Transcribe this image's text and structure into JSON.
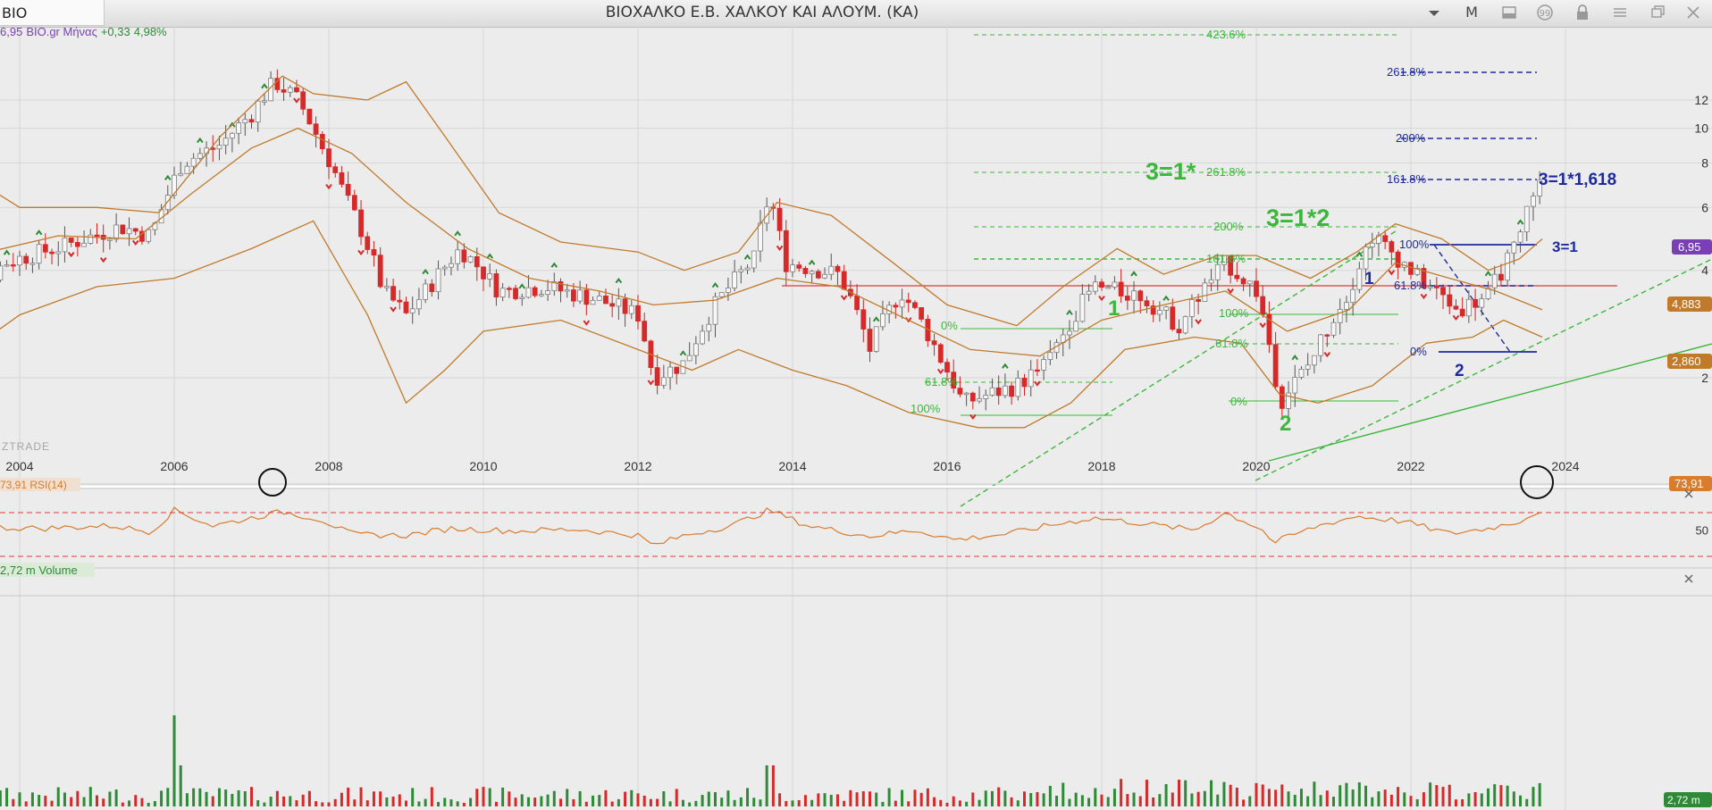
{
  "symbol": "BIO",
  "title": "ΒΙΟΧΑΛΚΟ Ε.Β. ΧΑΛΚΟΥ ΚΑΙ ΑΛΟΥΜ. (ΚΑ)",
  "period_button": "M",
  "toolbar_icons": [
    "chevron-down-icon",
    "layout-icon",
    "comment-icon",
    "lock-icon",
    "menu-icon",
    "restore-icon",
    "close-icon"
  ],
  "price_info": {
    "price": "6,95",
    "source": "BIO.gr Μήνας",
    "change": "+0,33",
    "change_pct": "4,98%"
  },
  "watermark": "ZTRADE",
  "rsi_label": "73,91 RSI(14)",
  "volume_label": "2,72 m Volume",
  "badges": {
    "price": "6,95",
    "upper_band": "4,883",
    "lower_band": "2,860",
    "rsi": "73,91",
    "volume": "2,72 m"
  },
  "colors": {
    "up": "#2e8a36",
    "down": "#d62a2a",
    "band": "#c07a2a",
    "fib": "#3cb73c",
    "blue": "#1e2a9e",
    "rsi": "#d87c2e",
    "price_badge": "#7a3fb5"
  },
  "chart_data": {
    "type": "candlestick",
    "x_ticks": [
      "2004",
      "2006",
      "2008",
      "2010",
      "2012",
      "2014",
      "2016",
      "2018",
      "2020",
      "2022",
      "2024"
    ],
    "y_ticks": [
      "12",
      "10",
      "8",
      "6",
      "4",
      "2"
    ],
    "y_scale": "log",
    "price_path": [
      [
        2003.2,
        2.9
      ],
      [
        2003.8,
        4.2
      ],
      [
        2004.6,
        4.7
      ],
      [
        2005.3,
        5.3
      ],
      [
        2005.7,
        5.0
      ],
      [
        2005.9,
        6.4
      ],
      [
        2006.1,
        8.0
      ],
      [
        2006.6,
        9.0
      ],
      [
        2007.0,
        11.0
      ],
      [
        2007.3,
        13.5
      ],
      [
        2007.6,
        12.0
      ],
      [
        2007.9,
        9.0
      ],
      [
        2008.2,
        6.5
      ],
      [
        2008.7,
        3.5
      ],
      [
        2009.0,
        3.0
      ],
      [
        2009.3,
        3.6
      ],
      [
        2009.7,
        4.6
      ],
      [
        2010.2,
        3.5
      ],
      [
        2010.8,
        3.6
      ],
      [
        2011.5,
        3.3
      ],
      [
        2012.0,
        3.0
      ],
      [
        2012.2,
        2.0
      ],
      [
        2012.6,
        2.2
      ],
      [
        2013.0,
        3.2
      ],
      [
        2013.5,
        4.3
      ],
      [
        2013.7,
        6.5
      ],
      [
        2013.9,
        4.2
      ],
      [
        2014.6,
        3.9
      ],
      [
        2015.0,
        2.4
      ],
      [
        2015.4,
        3.5
      ],
      [
        2015.9,
        2.3
      ],
      [
        2016.2,
        1.7
      ],
      [
        2016.9,
        1.9
      ],
      [
        2017.3,
        2.2
      ],
      [
        2017.9,
        3.6
      ],
      [
        2018.5,
        3.4
      ],
      [
        2019.0,
        2.8
      ],
      [
        2019.6,
        4.2
      ],
      [
        2020.0,
        3.5
      ],
      [
        2020.3,
        1.7
      ],
      [
        2020.7,
        2.2
      ],
      [
        2021.2,
        3.5
      ],
      [
        2021.5,
        5.0
      ],
      [
        2022.1,
        3.8
      ],
      [
        2022.6,
        3.1
      ],
      [
        2023.0,
        3.4
      ],
      [
        2023.4,
        4.8
      ],
      [
        2023.6,
        6.95
      ]
    ],
    "bb_upper": [
      [
        2003.0,
        8.2
      ],
      [
        2004.0,
        6.0
      ],
      [
        2005.0,
        6.0
      ],
      [
        2005.8,
        5.8
      ],
      [
        2006.6,
        9.5
      ],
      [
        2007.4,
        14.0
      ],
      [
        2007.8,
        12.5
      ],
      [
        2008.5,
        12.0
      ],
      [
        2009.0,
        13.5
      ],
      [
        2009.5,
        9.5
      ],
      [
        2010.2,
        5.8
      ],
      [
        2011.0,
        4.8
      ],
      [
        2012.0,
        4.5
      ],
      [
        2012.6,
        4.0
      ],
      [
        2013.3,
        4.5
      ],
      [
        2013.8,
        6.2
      ],
      [
        2014.5,
        5.7
      ],
      [
        2015.3,
        4.2
      ],
      [
        2016.0,
        3.2
      ],
      [
        2016.9,
        2.8
      ],
      [
        2017.5,
        3.6
      ],
      [
        2018.2,
        4.6
      ],
      [
        2018.8,
        3.9
      ],
      [
        2019.5,
        4.4
      ],
      [
        2020.0,
        4.4
      ],
      [
        2020.7,
        3.8
      ],
      [
        2021.3,
        4.5
      ],
      [
        2021.8,
        5.4
      ],
      [
        2022.4,
        4.9
      ],
      [
        2023.0,
        4.0
      ],
      [
        2023.4,
        4.3
      ],
      [
        2023.7,
        4.9
      ]
    ],
    "bb_middle": [
      [
        2003.0,
        4.2
      ],
      [
        2004.5,
        5.0
      ],
      [
        2005.5,
        4.9
      ],
      [
        2006.2,
        6.5
      ],
      [
        2007.0,
        8.8
      ],
      [
        2007.6,
        10.0
      ],
      [
        2008.3,
        8.5
      ],
      [
        2009.0,
        6.2
      ],
      [
        2009.8,
        4.6
      ],
      [
        2010.6,
        3.8
      ],
      [
        2011.5,
        3.5
      ],
      [
        2012.2,
        3.2
      ],
      [
        2013.0,
        3.3
      ],
      [
        2013.8,
        3.8
      ],
      [
        2014.6,
        3.6
      ],
      [
        2015.5,
        2.9
      ],
      [
        2016.3,
        2.4
      ],
      [
        2017.2,
        2.3
      ],
      [
        2018.0,
        2.9
      ],
      [
        2018.8,
        3.2
      ],
      [
        2019.6,
        3.5
      ],
      [
        2020.4,
        2.7
      ],
      [
        2021.2,
        3.1
      ],
      [
        2021.8,
        4.2
      ],
      [
        2022.5,
        3.8
      ],
      [
        2023.1,
        3.5
      ],
      [
        2023.7,
        3.1
      ]
    ],
    "bb_lower": [
      [
        2003.0,
        2.1
      ],
      [
        2004.0,
        3.0
      ],
      [
        2005.0,
        3.6
      ],
      [
        2006.0,
        3.8
      ],
      [
        2007.0,
        4.6
      ],
      [
        2007.8,
        5.5
      ],
      [
        2008.5,
        3.0
      ],
      [
        2009.0,
        1.7
      ],
      [
        2009.5,
        2.1
      ],
      [
        2010.0,
        2.7
      ],
      [
        2011.0,
        2.9
      ],
      [
        2012.0,
        2.4
      ],
      [
        2012.7,
        2.1
      ],
      [
        2013.3,
        2.4
      ],
      [
        2014.0,
        2.1
      ],
      [
        2014.7,
        1.9
      ],
      [
        2015.5,
        1.6
      ],
      [
        2016.4,
        1.45
      ],
      [
        2017.0,
        1.45
      ],
      [
        2017.6,
        1.7
      ],
      [
        2018.3,
        2.4
      ],
      [
        2019.2,
        2.6
      ],
      [
        2019.8,
        2.5
      ],
      [
        2020.3,
        1.8
      ],
      [
        2020.8,
        1.7
      ],
      [
        2021.5,
        1.9
      ],
      [
        2022.2,
        2.5
      ],
      [
        2022.8,
        2.6
      ],
      [
        2023.2,
        2.9
      ],
      [
        2023.7,
        2.6
      ]
    ],
    "rsi": [
      [
        2003.0,
        42
      ],
      [
        2003.6,
        53
      ],
      [
        2004.3,
        52
      ],
      [
        2005.2,
        55
      ],
      [
        2005.7,
        48
      ],
      [
        2006.0,
        73
      ],
      [
        2006.5,
        55
      ],
      [
        2007.0,
        64
      ],
      [
        2007.4,
        71
      ],
      [
        2007.9,
        62
      ],
      [
        2008.3,
        45
      ],
      [
        2009.0,
        44
      ],
      [
        2009.6,
        52
      ],
      [
        2010.4,
        49
      ],
      [
        2011.2,
        51
      ],
      [
        2012.0,
        44
      ],
      [
        2012.2,
        32
      ],
      [
        2012.6,
        44
      ],
      [
        2013.2,
        55
      ],
      [
        2013.7,
        73
      ],
      [
        2014.2,
        55
      ],
      [
        2015.0,
        43
      ],
      [
        2015.6,
        50
      ],
      [
        2016.1,
        39
      ],
      [
        2016.8,
        46
      ],
      [
        2017.3,
        55
      ],
      [
        2017.9,
        64
      ],
      [
        2018.5,
        58
      ],
      [
        2019.2,
        50
      ],
      [
        2019.6,
        70
      ],
      [
        2020.1,
        50
      ],
      [
        2020.2,
        35
      ],
      [
        2020.8,
        55
      ],
      [
        2021.3,
        66
      ],
      [
        2021.9,
        60
      ],
      [
        2022.5,
        46
      ],
      [
        2023.0,
        52
      ],
      [
        2023.4,
        60
      ],
      [
        2023.7,
        73.91
      ]
    ],
    "rsi_levels": [
      70,
      30
    ],
    "rsi_ticks": [
      "50"
    ],
    "fib_labels_green": [
      "423.6%",
      "261.8%",
      "200%",
      "161.8%",
      "100%",
      "61.8%",
      "0%",
      "0%",
      "61.8%",
      "100%",
      "100%",
      "61.8%",
      "0%"
    ],
    "fib_labels_blue": [
      "261.8%",
      "200%",
      "161.8%",
      "100%",
      "61.8%",
      "0%"
    ],
    "annotations": {
      "green_1": "1",
      "green_2": "2",
      "blue_1": "1",
      "blue_2": "2",
      "eq_1star": "3=1*",
      "eq_1x2": "3=1*2",
      "eq_blue_1618": "3=1*1,618",
      "eq_blue_1": "3=1"
    }
  }
}
